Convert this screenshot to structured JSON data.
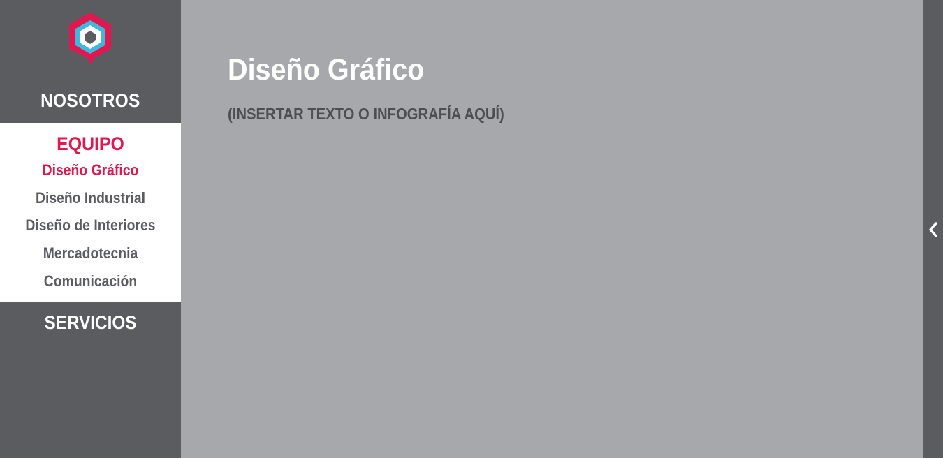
{
  "sidebar": {
    "logo_icon": "hexagon-logo-icon",
    "nav_top_label": "NOSOTROS",
    "submenu": {
      "title": "EQUIPO",
      "items": [
        {
          "label": "Diseño Gráfico",
          "active": true
        },
        {
          "label": "Diseño Industrial",
          "active": false
        },
        {
          "label": "Diseño de Interiores",
          "active": false
        },
        {
          "label": "Mercadotecnia",
          "active": false
        },
        {
          "label": "Comunicación",
          "active": false
        }
      ]
    },
    "nav_bottom_label": "SERVICIOS"
  },
  "main": {
    "title": "Diseño Gráfico",
    "subtitle": "(INSERTAR TEXTO O INFOGRAFÍA AQUÍ)"
  },
  "right_panel": {
    "toggle_icon": "chevron-left-icon"
  },
  "colors": {
    "sidebar_bg": "#5b5c60",
    "main_bg": "#a7a8ac",
    "accent": "#e0184f",
    "logo_blue": "#3fb8dc"
  }
}
